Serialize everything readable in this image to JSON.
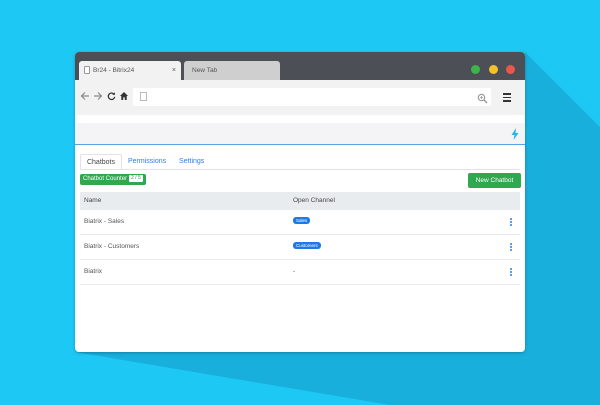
{
  "browser": {
    "tabs": [
      {
        "label": "Br24 - Bitrix24",
        "close": "×"
      },
      {
        "label": "New Tab"
      }
    ],
    "window_controls": {
      "green": "#3bb54a",
      "yellow": "#f5c02a",
      "red": "#e8574a"
    },
    "address_value": "",
    "icons": [
      "back-arrow-icon",
      "forward-arrow-icon",
      "reload-icon",
      "home-icon",
      "page-icon",
      "zoom-icon",
      "menu-icon"
    ]
  },
  "app": {
    "accent_icon": "lightning-bolt-icon",
    "tabs": [
      {
        "label": "Chatbots",
        "active": true
      },
      {
        "label": "Permissions",
        "active": false
      },
      {
        "label": "Settings",
        "active": false
      }
    ],
    "counter": {
      "label": "Chatbot Counter",
      "count": "2 / 5"
    },
    "new_button": "New Chatbot",
    "table": {
      "headers": [
        "Name",
        "Open Channel"
      ],
      "rows": [
        {
          "name": "Biatrix - Sales",
          "channel": "Sales",
          "is_badge": true
        },
        {
          "name": "Biatrix - Customers",
          "channel": "Customers",
          "is_badge": true
        },
        {
          "name": "Biatrix",
          "channel": "-",
          "is_badge": false
        }
      ]
    }
  },
  "colors": {
    "background": "#1ec8f5",
    "green": "#2fa84f",
    "link": "#2f7ee0",
    "badge": "#1f7ae6"
  }
}
